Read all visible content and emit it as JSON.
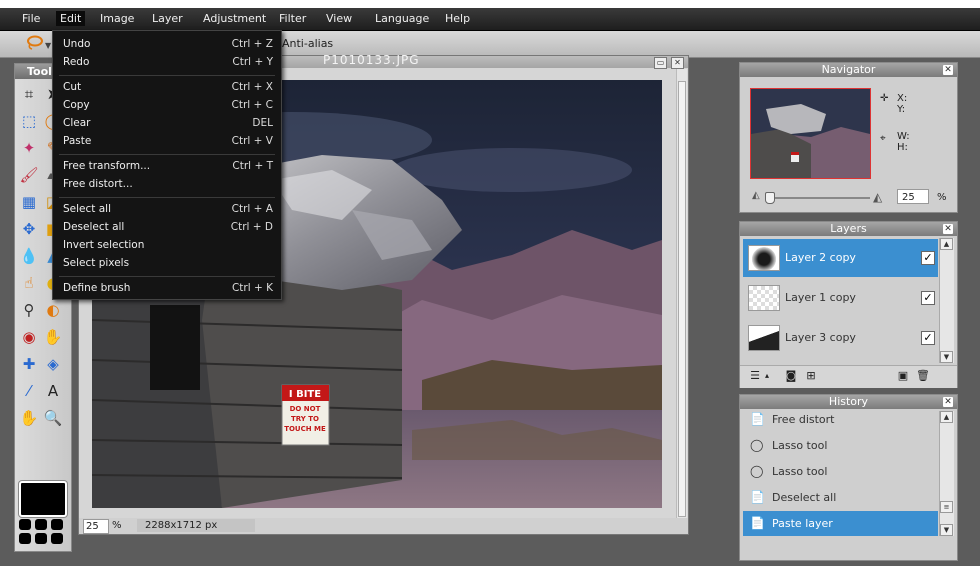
{
  "menubar": {
    "items": [
      "File",
      "Edit",
      "Image",
      "Layer",
      "Adjustment",
      "Filter",
      "View",
      "Language",
      "Help"
    ]
  },
  "toolbar": {
    "antialias_label": "Anti-alias"
  },
  "tools": {
    "title": "Tools",
    "icons": [
      "crop-icon",
      "move-icon",
      "marquee-icon",
      "lasso-icon",
      "wand-icon",
      "pencil-icon",
      "brush-icon",
      "eraser-icon",
      "gradient-icon",
      "fill-icon",
      "replace-color-icon",
      "shape-icon",
      "blur-icon",
      "sharpen-icon",
      "smudge-icon",
      "sponge-icon",
      "clone-icon",
      "dodge-icon",
      "red-eye-icon",
      "burn-icon",
      "spot-heal-icon",
      "bloat-icon",
      "picker-icon",
      "type-icon",
      "hand-icon",
      "zoom-icon"
    ],
    "foreground_color": "#000000"
  },
  "edit_menu": {
    "groups": [
      [
        {
          "label": "Undo",
          "shortcut": "Ctrl + Z"
        },
        {
          "label": "Redo",
          "shortcut": "Ctrl + Y"
        }
      ],
      [
        {
          "label": "Cut",
          "shortcut": "Ctrl + X"
        },
        {
          "label": "Copy",
          "shortcut": "Ctrl + C"
        },
        {
          "label": "Clear",
          "shortcut": "DEL"
        },
        {
          "label": "Paste",
          "shortcut": "Ctrl + V"
        }
      ],
      [
        {
          "label": "Free transform...",
          "shortcut": "Ctrl + T"
        },
        {
          "label": "Free distort...",
          "shortcut": ""
        }
      ],
      [
        {
          "label": "Select all",
          "shortcut": "Ctrl + A"
        },
        {
          "label": "Deselect all",
          "shortcut": "Ctrl + D"
        },
        {
          "label": "Invert selection",
          "shortcut": ""
        },
        {
          "label": "Select pixels",
          "shortcut": ""
        }
      ],
      [
        {
          "label": "Define brush",
          "shortcut": "Ctrl + K"
        }
      ]
    ]
  },
  "image_window": {
    "title": "P1010133.JPG",
    "zoom": "25",
    "zoom_unit": "%",
    "size": "2288x1712 px",
    "sign_text": [
      "I BITE",
      "DO NOT",
      "TRY TO",
      "TOUCH ME"
    ]
  },
  "navigator": {
    "title": "Navigator",
    "x_label": "X:",
    "y_label": "Y:",
    "w_label": "W:",
    "h_label": "H:",
    "zoom": "25",
    "zoom_unit": "%"
  },
  "layers": {
    "title": "Layers",
    "items": [
      {
        "name": "Layer 2 copy",
        "selected": true,
        "visible": true
      },
      {
        "name": "Layer 1 copy",
        "selected": false,
        "visible": true
      },
      {
        "name": "Layer 3 copy",
        "selected": false,
        "visible": true
      }
    ]
  },
  "history": {
    "title": "History",
    "items": [
      {
        "label": "Free distort",
        "icon": "document-icon",
        "selected": false
      },
      {
        "label": "Lasso tool",
        "icon": "lasso-icon",
        "selected": false
      },
      {
        "label": "Lasso tool",
        "icon": "lasso-icon",
        "selected": false
      },
      {
        "label": "Deselect all",
        "icon": "document-icon",
        "selected": false
      },
      {
        "label": "Paste layer",
        "icon": "document-icon",
        "selected": true
      }
    ]
  },
  "colors": {
    "accent": "#3b8fd0",
    "menu_bg": "#141414",
    "workspace": "#5c5c5c"
  }
}
